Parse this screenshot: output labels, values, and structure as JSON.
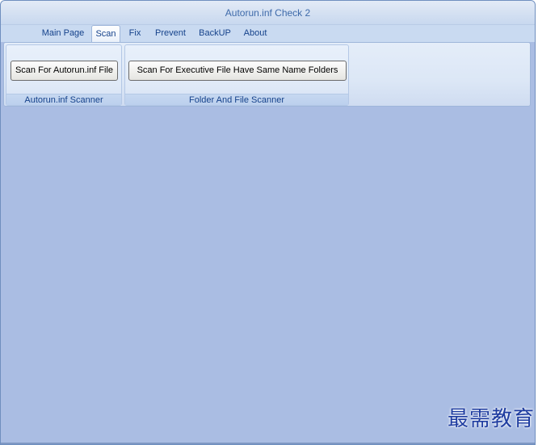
{
  "window": {
    "title": "Autorun.inf Check 2"
  },
  "ribbon": {
    "tabs": [
      {
        "label": "Main Page"
      },
      {
        "label": "Scan"
      },
      {
        "label": "Fix"
      },
      {
        "label": "Prevent"
      },
      {
        "label": "BackUP"
      },
      {
        "label": "About"
      }
    ],
    "active_tab": "Scan",
    "groups": [
      {
        "label": "Autorun.inf Scanner",
        "button": "Scan For Autorun.inf File"
      },
      {
        "label": "Folder And File Scanner",
        "button": "Scan For Executive File Have Same Name Folders"
      }
    ]
  },
  "watermark": "最需教育",
  "colors": {
    "client_background": "#aabde3",
    "title_text": "#3e6aaa",
    "tab_text": "#15428b"
  }
}
